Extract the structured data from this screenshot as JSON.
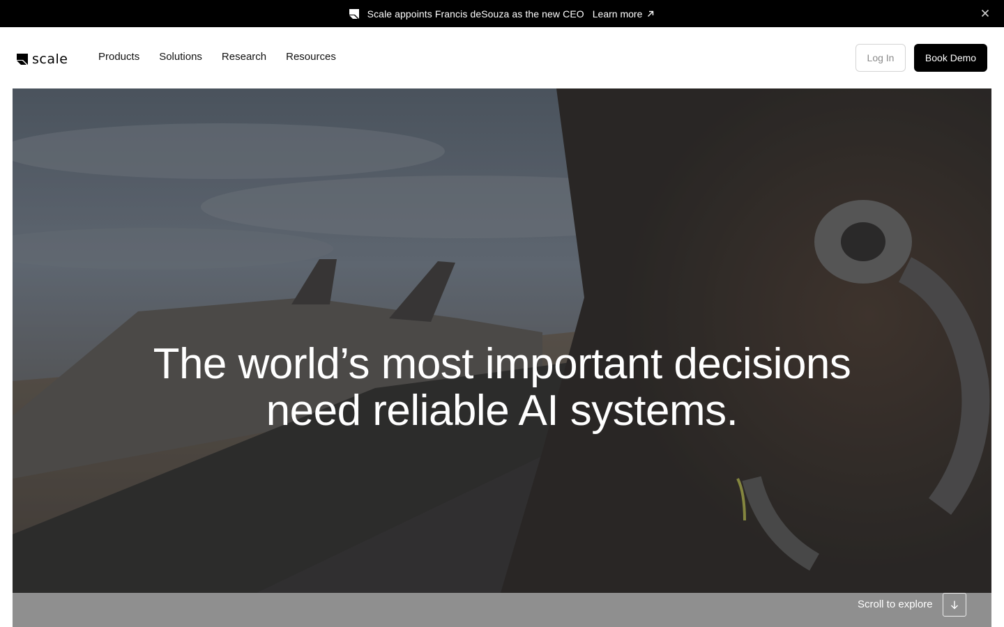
{
  "announcement": {
    "message": "Scale appoints Francis deSouza as the new CEO",
    "link_label": "Learn more"
  },
  "brand": {
    "wordmark": "scale"
  },
  "nav": {
    "items": [
      {
        "label": "Products"
      },
      {
        "label": "Solutions"
      },
      {
        "label": "Research"
      },
      {
        "label": "Resources"
      }
    ]
  },
  "actions": {
    "login_label": "Log In",
    "demo_label": "Book Demo"
  },
  "hero": {
    "headline_line1": "The world’s most important decisions",
    "headline_line2": "need reliable AI systems.",
    "scroll_label": "Scroll to explore"
  },
  "icons": {
    "announcement_logo": "scale-mark-icon",
    "external_arrow": "arrow-up-right-icon",
    "close": "close-icon",
    "scroll_down": "arrow-down-icon"
  },
  "colors": {
    "announcement_bg": "#000000",
    "primary_button_bg": "#000000",
    "hero_text": "#ffffff"
  }
}
